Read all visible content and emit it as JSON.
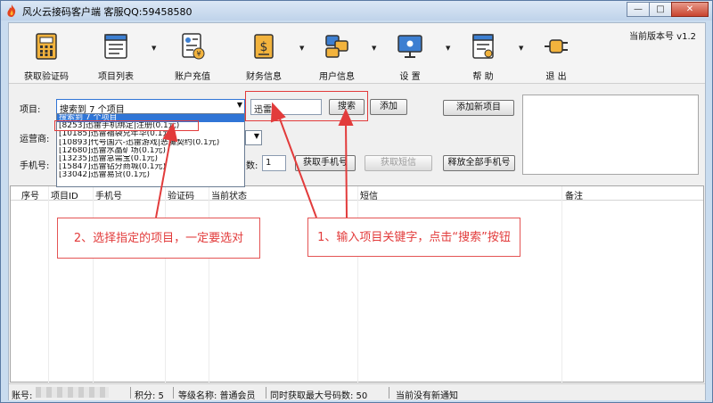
{
  "window": {
    "title": "风火云接码客户端   客服QQ:59458580",
    "min": "—",
    "max": "□",
    "close": "✕"
  },
  "toolbar": {
    "items": [
      {
        "label": "获取验证码",
        "icon": "calculator-icon",
        "has_arrow": false
      },
      {
        "label": "项目列表",
        "icon": "list-icon",
        "has_arrow": true
      },
      {
        "label": "账户充值",
        "icon": "account-recharge-icon",
        "has_arrow": false
      },
      {
        "label": "财务信息",
        "icon": "finance-icon",
        "has_arrow": true
      },
      {
        "label": "用户信息",
        "icon": "user-info-icon",
        "has_arrow": true
      },
      {
        "label": "设  置",
        "icon": "monitor-settings-icon",
        "has_arrow": true
      },
      {
        "label": "帮  助",
        "icon": "help-document-icon",
        "has_arrow": true
      },
      {
        "label": "退  出",
        "icon": "exit-plug-icon",
        "has_arrow": false
      }
    ],
    "version_label": "当前版本号 v1.2"
  },
  "form": {
    "project_label": "项目:",
    "project_selected": "搜索到 7 个项目",
    "search_value": "迅雷",
    "search_button": "搜索",
    "add_button": "添加",
    "add_new_project_button": "添加新项目",
    "carrier_label": "运营商:",
    "phone_label": "手机号:",
    "count_label": "数:",
    "count_value": "1",
    "get_phone_button": "获取手机号",
    "get_sms_button": "获取短信",
    "release_all_button": "释放全部手机号"
  },
  "dropdown": {
    "items": [
      "搜索到 7 个项目",
      "[8253]迅雷手机绑定|注册(0.1元)",
      "[10185]迅雷福袋兑年华(0.1元)",
      "[10893]代号国六-迅雷游戏|恶魔契约(0.1元)",
      "[12680]迅雷水晶矿场(0.1元)",
      "[13235]迅雷急需宝(0.1元)",
      "[15847]迅雷钻分商城(0.1元)",
      "[33042]迅雷易贷(0.1元)"
    ]
  },
  "table": {
    "columns": [
      "序号",
      "项目ID",
      "手机号",
      "验证码",
      "当前状态",
      "短信",
      "备注"
    ]
  },
  "annotations": {
    "step2": "2、选择指定的项目，一定要选对",
    "step1": "1、输入项目关键字，点击“搜索”按钮"
  },
  "statusbar": {
    "account_label": "账号:",
    "points": "积分: 5",
    "level": "等级名称: 普通会员",
    "max_numbers": "同时获取最大号码数: 50",
    "notice": "当前没有新通知"
  }
}
